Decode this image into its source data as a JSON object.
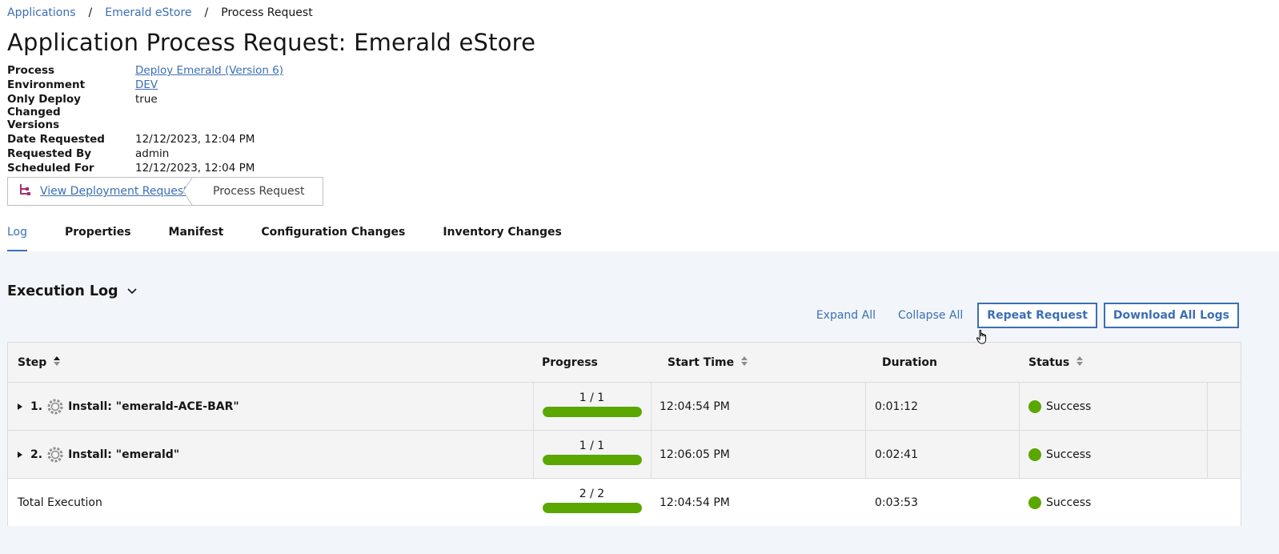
{
  "breadcrumb": {
    "items": [
      "Applications",
      "Emerald eStore"
    ],
    "separator": "/",
    "current": "Process Request"
  },
  "page_title": "Application Process Request: Emerald eStore",
  "details": [
    {
      "label": "Process",
      "value": "Deploy Emerald (Version 6)",
      "link": true
    },
    {
      "label": "Environment",
      "value": "DEV",
      "link": true
    },
    {
      "label": "Only Deploy Changed Versions",
      "value": "true",
      "link": false
    },
    {
      "label": "Date Requested",
      "value": "12/12/2023, 12:04 PM",
      "link": false
    },
    {
      "label": "Requested By",
      "value": "admin",
      "link": false
    },
    {
      "label": "Scheduled For",
      "value": "12/12/2023, 12:04 PM",
      "link": false
    }
  ],
  "request_nav": {
    "view_deployment": "View Deployment Request",
    "process_request": "Process Request",
    "icon": "hierarchy-icon"
  },
  "tabs": [
    "Log",
    "Properties",
    "Manifest",
    "Configuration Changes",
    "Inventory Changes"
  ],
  "active_tab": "Log",
  "execution_log": {
    "title": "Execution Log",
    "expand_all": "Expand All",
    "collapse_all": "Collapse All",
    "repeat_request": "Repeat Request",
    "download_all_logs": "Download All Logs"
  },
  "table": {
    "columns": [
      "Step",
      "Progress",
      "Start Time",
      "Duration",
      "Status"
    ],
    "rows": [
      {
        "num": "1.",
        "name": "Install: \"emerald-ACE-BAR\"",
        "progress": "1 / 1",
        "progress_fraction": 1.0,
        "start": "12:04:54 PM",
        "duration": "0:01:12",
        "status": "Success"
      },
      {
        "num": "2.",
        "name": "Install: \"emerald\"",
        "progress": "1 / 1",
        "progress_fraction": 1.0,
        "start": "12:06:05 PM",
        "duration": "0:02:41",
        "status": "Success"
      }
    ],
    "total": {
      "label": "Total Execution",
      "progress": "2 / 2",
      "progress_fraction": 1.0,
      "start": "12:04:54 PM",
      "duration": "0:03:53",
      "status": "Success"
    }
  },
  "colors": {
    "link": "#3b6fb6",
    "success": "#5aa700",
    "panel_bg": "#f2f5f9"
  }
}
